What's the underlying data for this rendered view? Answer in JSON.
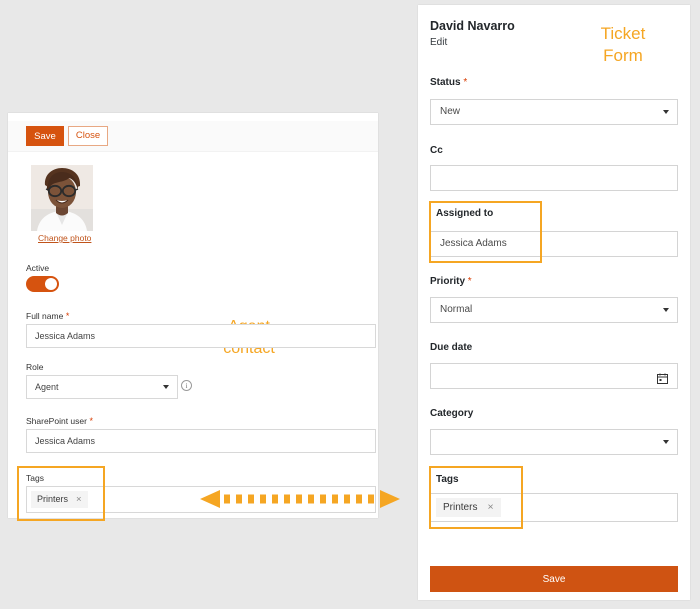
{
  "colors": {
    "accent_orange": "#d6530f",
    "annotation_orange": "#f5a623",
    "save_button": "#cf5312",
    "required_red": "#d83b01",
    "page_background": "#e8e8e8",
    "panel_background": "#ffffff"
  },
  "annotations": {
    "left_label": "Agent\ncontact",
    "left_label_line1": "Agent",
    "left_label_line2": "contact",
    "right_label_line1": "Ticket",
    "right_label_line2": "Form",
    "arrow": "double-headed-dashed-arrow"
  },
  "agent_form": {
    "command_bar": {
      "save_label": "Save",
      "close_label": "Close"
    },
    "photo": {
      "change_photo_label": "Change photo",
      "alt": "agent-portrait"
    },
    "fields": [
      {
        "label": "Active",
        "required": false,
        "type": "toggle",
        "value": "on"
      },
      {
        "label": "Full name",
        "required": true,
        "type": "text",
        "value": "Jessica Adams"
      },
      {
        "label": "Role",
        "required": false,
        "type": "dropdown",
        "value": "Agent",
        "has_info_icon": true
      },
      {
        "label": "SharePoint user",
        "required": true,
        "type": "text",
        "value": "Jessica Adams"
      },
      {
        "label": "Tags",
        "required": false,
        "type": "tags",
        "chips": [
          "Printers"
        ],
        "highlighted": true
      }
    ]
  },
  "ticket_form": {
    "title": "David Navarro",
    "subtitle": "Edit",
    "fields": [
      {
        "label": "Status",
        "required": true,
        "type": "dropdown",
        "value": "New"
      },
      {
        "label": "Cc",
        "required": false,
        "type": "text",
        "value": ""
      },
      {
        "label": "Assigned to",
        "required": false,
        "type": "person",
        "value": "Jessica Adams",
        "highlighted": true
      },
      {
        "label": "Priority",
        "required": true,
        "type": "dropdown",
        "value": "Normal"
      },
      {
        "label": "Due date",
        "required": false,
        "type": "date",
        "value": "",
        "icon": "calendar-icon"
      },
      {
        "label": "Category",
        "required": false,
        "type": "dropdown",
        "value": ""
      },
      {
        "label": "Tags",
        "required": false,
        "type": "tags",
        "chips": [
          "Printers"
        ],
        "highlighted": true
      }
    ],
    "save_label": "Save"
  },
  "chip_remove_glyph": "×"
}
